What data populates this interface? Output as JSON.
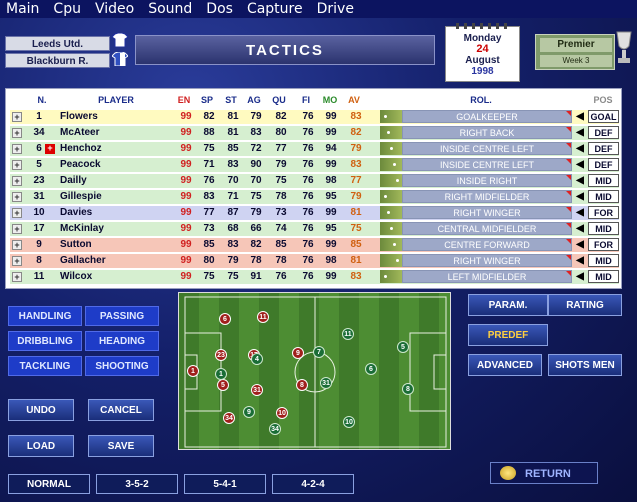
{
  "menu": [
    "Main",
    "Cpu",
    "Video",
    "Sound",
    "Dos",
    "Capture",
    "Drive"
  ],
  "header": {
    "home_team": "Leeds Utd.",
    "away_team": "Blackburn R.",
    "title": "TACTICS",
    "calendar": {
      "weekday": "Monday",
      "day": "24",
      "month": "August",
      "year": "1998"
    },
    "league": {
      "name": "Premier",
      "week": "Week 3"
    }
  },
  "table": {
    "columns": [
      "N.",
      "PLAYER",
      "EN",
      "SP",
      "ST",
      "AG",
      "QU",
      "FI",
      "MO",
      "AV",
      "ROL.",
      "POS"
    ],
    "rows": [
      {
        "n": "1",
        "name": "Flowers",
        "en": "99",
        "sp": "82",
        "st": "81",
        "ag": "79",
        "qu": "82",
        "fi": "76",
        "mo": "99",
        "av": "83",
        "role": "GOALKEEPER",
        "pos": "GOAL",
        "flag": false,
        "bg": "#fffac0"
      },
      {
        "n": "34",
        "name": "McAteer",
        "en": "99",
        "sp": "88",
        "st": "81",
        "ag": "83",
        "qu": "80",
        "fi": "76",
        "mo": "99",
        "av": "82",
        "role": "RIGHT BACK",
        "pos": "DEF",
        "flag": false,
        "bg": "#d6efd0"
      },
      {
        "n": "6",
        "name": "Henchoz",
        "en": "99",
        "sp": "75",
        "st": "85",
        "ag": "72",
        "qu": "77",
        "fi": "76",
        "mo": "94",
        "av": "79",
        "role": "INSIDE CENTRE LEFT",
        "pos": "DEF",
        "flag": true,
        "bg": "#d6efd0"
      },
      {
        "n": "5",
        "name": "Peacock",
        "en": "99",
        "sp": "71",
        "st": "83",
        "ag": "90",
        "qu": "79",
        "fi": "76",
        "mo": "99",
        "av": "83",
        "role": "INSIDE CENTRE LEFT",
        "pos": "DEF",
        "flag": false,
        "bg": "#d6efd0"
      },
      {
        "n": "23",
        "name": "Dailly",
        "en": "99",
        "sp": "76",
        "st": "70",
        "ag": "70",
        "qu": "75",
        "fi": "76",
        "mo": "98",
        "av": "77",
        "role": "INSIDE RIGHT",
        "pos": "MID",
        "flag": false,
        "bg": "#d6efd0"
      },
      {
        "n": "31",
        "name": "Gillespie",
        "en": "99",
        "sp": "83",
        "st": "71",
        "ag": "75",
        "qu": "78",
        "fi": "76",
        "mo": "95",
        "av": "79",
        "role": "RIGHT MIDFIELDER",
        "pos": "MID",
        "flag": false,
        "bg": "#d6efd0"
      },
      {
        "n": "10",
        "name": "Davies",
        "en": "99",
        "sp": "77",
        "st": "87",
        "ag": "79",
        "qu": "73",
        "fi": "76",
        "mo": "99",
        "av": "81",
        "role": "RIGHT WINGER",
        "pos": "FOR",
        "flag": false,
        "bg": "#cfd3f2"
      },
      {
        "n": "17",
        "name": "McKinlay",
        "en": "99",
        "sp": "73",
        "st": "68",
        "ag": "66",
        "qu": "74",
        "fi": "76",
        "mo": "95",
        "av": "75",
        "role": "CENTRAL MIDFIELDER",
        "pos": "MID",
        "flag": false,
        "bg": "#d6efd0"
      },
      {
        "n": "9",
        "name": "Sutton",
        "en": "99",
        "sp": "85",
        "st": "83",
        "ag": "82",
        "qu": "85",
        "fi": "76",
        "mo": "99",
        "av": "85",
        "role": "CENTRE FORWARD",
        "pos": "FOR",
        "flag": false,
        "bg": "#f6c6b8"
      },
      {
        "n": "8",
        "name": "Gallacher",
        "en": "99",
        "sp": "80",
        "st": "79",
        "ag": "78",
        "qu": "78",
        "fi": "76",
        "mo": "98",
        "av": "81",
        "role": "RIGHT WINGER",
        "pos": "MID",
        "flag": false,
        "bg": "#f6c6b8"
      },
      {
        "n": "11",
        "name": "Wilcox",
        "en": "99",
        "sp": "75",
        "st": "75",
        "ag": "91",
        "qu": "76",
        "fi": "76",
        "mo": "99",
        "av": "83",
        "role": "LEFT MIDFIELDER",
        "pos": "MID",
        "flag": false,
        "bg": "#d6efd0"
      }
    ]
  },
  "attributes": [
    "HANDLING",
    "PASSING",
    "DRIBBLING",
    "HEADING",
    "TACKLING",
    "SHOOTING"
  ],
  "buttons": {
    "undo": "UNDO",
    "cancel": "CANCEL",
    "load": "LOAD",
    "save": "SAVE",
    "param": "PARAM.",
    "rating": "RATING",
    "predef": "PREDEF",
    "advanced": "ADVANCED",
    "shots_men": "SHOTS MEN",
    "return": "RETURN"
  },
  "formations": [
    "NORMAL",
    "3-5-2",
    "5-4-1",
    "4-2-4"
  ],
  "field_players": {
    "home": [
      "6",
      "11",
      "23",
      "17",
      "9",
      "1",
      "5",
      "31",
      "8",
      "34",
      "10"
    ],
    "away": [
      "11",
      "7",
      "1",
      "8",
      "31",
      "4",
      "5",
      "9",
      "6",
      "10",
      "34"
    ]
  },
  "colors": {
    "accent": "#1e3cc8",
    "predef_text": "#ffd040"
  }
}
